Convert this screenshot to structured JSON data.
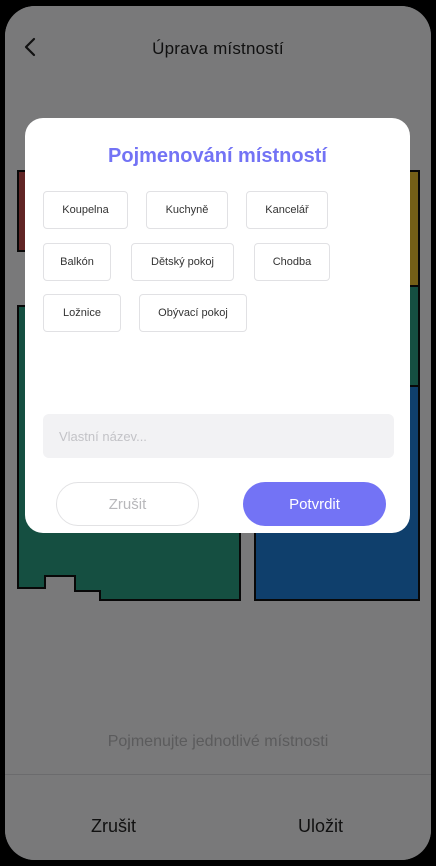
{
  "header": {
    "title": "Úprava místností",
    "back_icon": "chevron-left-icon"
  },
  "map": {
    "room_colors": {
      "green": "#2a9e82",
      "blue": "#1e7fd8",
      "yellow": "#e8bf2e",
      "red": "#c24b4b",
      "outline": "#111111"
    }
  },
  "hint": "Pojmenujte jednotlivé místnosti",
  "bottom": {
    "cancel_label": "Zrušit",
    "save_label": "Uložit"
  },
  "dialog": {
    "title": "Pojmenování místností",
    "room_names": [
      "Koupelna",
      "Kuchyně",
      "Kancelář",
      "Balkón",
      "Dětský pokoj",
      "Chodba",
      "Ložnice",
      "Obývací pokoj"
    ],
    "input_placeholder": "Vlastní název...",
    "cancel_label": "Zrušit",
    "confirm_label": "Potvrdit",
    "accent_color": "#7373f5"
  }
}
